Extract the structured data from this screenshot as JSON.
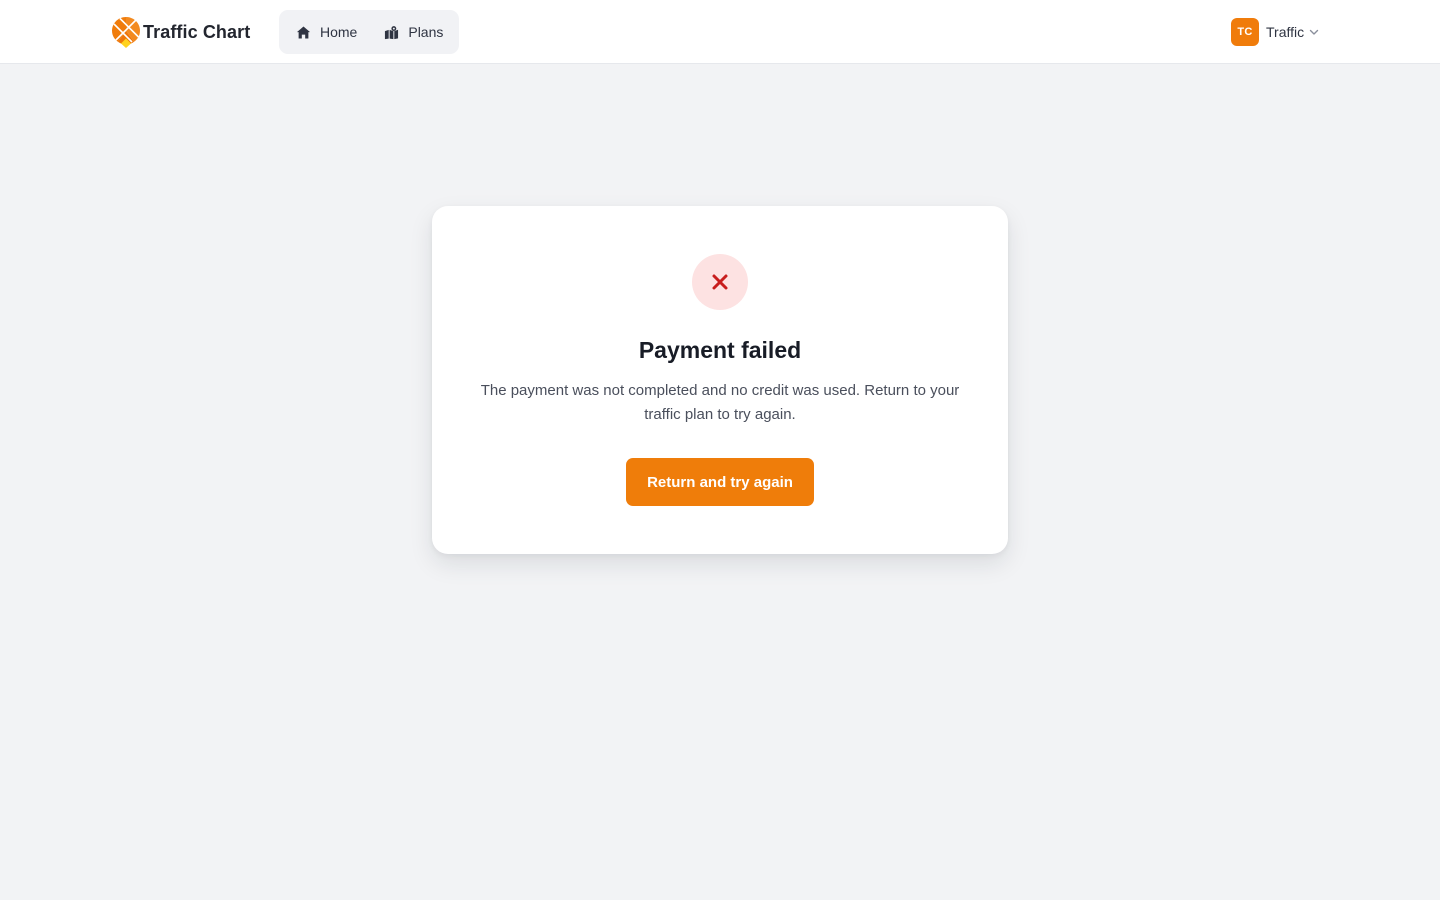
{
  "app": {
    "brand": "Traffic Chart",
    "accent_color": "#ef7d0a"
  },
  "nav": {
    "items": [
      {
        "label": "Home",
        "icon": "home-icon"
      },
      {
        "label": "Plans",
        "icon": "map-icon"
      }
    ]
  },
  "user": {
    "initials": "TC",
    "name": "Traffic",
    "menu_icon": "chevron-down-icon"
  },
  "result": {
    "status_icon": "close-icon",
    "status_color": "#c81e1e",
    "title": "Payment failed",
    "message": "The payment was not completed and no credit was used. Return to your traffic plan to try again.",
    "button_label": "Return and try again"
  }
}
